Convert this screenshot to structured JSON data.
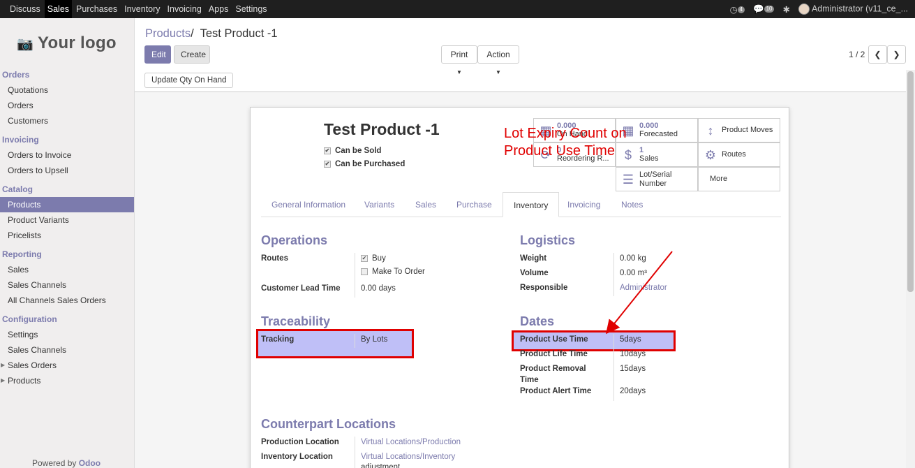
{
  "topbar": {
    "menu": [
      {
        "label": "Discuss",
        "active": false
      },
      {
        "label": "Sales",
        "active": true
      },
      {
        "label": "Purchases",
        "active": false
      },
      {
        "label": "Inventory",
        "active": false
      },
      {
        "label": "Invoicing",
        "active": false
      },
      {
        "label": "Apps",
        "active": false
      },
      {
        "label": "Settings",
        "active": false
      }
    ],
    "activity_count": "4",
    "message_count": "10",
    "user": "Administrator (v11_ce_..."
  },
  "sidebar": {
    "logo": "Your logo",
    "sections": [
      {
        "title": "Orders",
        "items": [
          {
            "label": "Quotations"
          },
          {
            "label": "Orders"
          },
          {
            "label": "Customers"
          }
        ]
      },
      {
        "title": "Invoicing",
        "items": [
          {
            "label": "Orders to Invoice"
          },
          {
            "label": "Orders to Upsell"
          }
        ]
      },
      {
        "title": "Catalog",
        "items": [
          {
            "label": "Products",
            "active": true
          },
          {
            "label": "Product Variants"
          },
          {
            "label": "Pricelists"
          }
        ]
      },
      {
        "title": "Reporting",
        "items": [
          {
            "label": "Sales"
          },
          {
            "label": "Sales Channels"
          },
          {
            "label": "All Channels Sales Orders"
          }
        ]
      },
      {
        "title": "Configuration",
        "items": [
          {
            "label": "Settings"
          },
          {
            "label": "Sales Channels"
          },
          {
            "label": "Sales Orders",
            "caret": true
          },
          {
            "label": "Products",
            "caret": true
          }
        ]
      }
    ],
    "powered_prefix": "Powered by",
    "powered_brand": "Odoo"
  },
  "control_panel": {
    "breadcrumb_parent": "Products",
    "breadcrumb_sep": "/",
    "breadcrumb_current": "Test Product -1",
    "edit_label": "Edit",
    "create_label": "Create",
    "print_label": "Print",
    "action_label": "Action",
    "pager": "1 / 2",
    "update_qty_label": "Update Qty On Hand"
  },
  "product": {
    "name": "Test Product -1",
    "can_be_sold": "Can be Sold",
    "can_be_purchased": "Can be Purchased"
  },
  "smart_buttons": {
    "on_hand": {
      "value": "0.000",
      "label": "On Hand"
    },
    "forecasted": {
      "value": "0.000",
      "label": "Forecasted"
    },
    "moves": {
      "label": "Product Moves"
    },
    "reordering": {
      "value": "0",
      "label": "Reordering R..."
    },
    "sales": {
      "value": "1",
      "label": "Sales"
    },
    "routes": {
      "label": "Routes"
    },
    "lots": {
      "label1": "Lot/Serial",
      "label2": "Number"
    },
    "more": {
      "label": "More"
    }
  },
  "tabs": [
    "General Information",
    "Variants",
    "Sales",
    "Purchase",
    "Inventory",
    "Invoicing",
    "Notes"
  ],
  "operations": {
    "title": "Operations",
    "routes_label": "Routes",
    "buy": "Buy",
    "mto": "Make To Order",
    "lead_label": "Customer Lead Time",
    "lead_value": "0.00 days"
  },
  "logistics": {
    "title": "Logistics",
    "weight_label": "Weight",
    "weight_value": "0.00",
    "weight_unit": "kg",
    "volume_label": "Volume",
    "volume_value": "0.00",
    "volume_unit": "m³",
    "responsible_label": "Responsible",
    "responsible_value": "Administrator"
  },
  "traceability": {
    "title": "Traceability",
    "tracking_label": "Tracking",
    "tracking_value": "By Lots"
  },
  "dates": {
    "title": "Dates",
    "use_label": "Product Use Time",
    "use_value": "5days",
    "life_label": "Product Life Time",
    "life_value": "10days",
    "removal_label1": "Product Removal",
    "removal_label2": "Time",
    "removal_value": "15days",
    "alert_label": "Product Alert Time",
    "alert_value": "20days"
  },
  "counterpart": {
    "title": "Counterpart Locations",
    "production_label": "Production Location",
    "production_value": "Virtual Locations/Production",
    "inventory_label": "Inventory Location",
    "inventory_value": "Virtual Locations/Inventory",
    "inventory_value2": "adjustment"
  },
  "annotation": {
    "line1": "Lot Expiry Count on",
    "line2": "Product Use Time"
  },
  "colors": {
    "accent": "#7c7bad",
    "highlight_border": "#e00000",
    "topbar": "#1f1f1f"
  }
}
